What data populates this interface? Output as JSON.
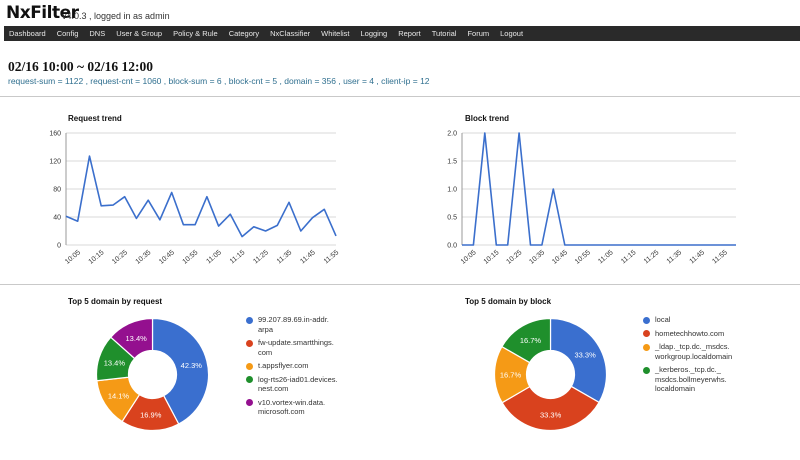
{
  "header": {
    "logo": "NxFilter",
    "version": "v4.0.3 , logged in as admin"
  },
  "nav": {
    "items": [
      "Dashboard",
      "Config",
      "DNS",
      "User & Group",
      "Policy & Rule",
      "Category",
      "NxClassifier",
      "Whitelist",
      "Logging",
      "Report",
      "Tutorial",
      "Forum",
      "Logout"
    ]
  },
  "period": "02/16 10:00 ~ 02/16 12:00",
  "summary": "request-sum = 1122 , request-cnt = 1060 , block-sum = 6 , block-cnt = 5 , domain = 356 , user = 4 , client-ip = 12",
  "chart_data": [
    {
      "type": "line",
      "title": "Request trend",
      "x": [
        "10:01",
        "10:05",
        "10:10",
        "10:15",
        "10:20",
        "10:25",
        "10:30",
        "10:35",
        "10:40",
        "10:45",
        "10:50",
        "10:55",
        "11:00",
        "11:05",
        "11:10",
        "11:15",
        "11:20",
        "11:25",
        "11:30",
        "11:35",
        "11:40",
        "11:45",
        "11:50",
        "11:55",
        "12:00"
      ],
      "tick_labels": [
        "10:05",
        "10:15",
        "10:25",
        "10:35",
        "10:45",
        "10:55",
        "11:05",
        "11:15",
        "11:25",
        "11:35",
        "11:45",
        "11:55"
      ],
      "values": [
        41,
        34,
        127,
        56,
        57,
        69,
        38,
        64,
        36,
        75,
        29,
        29,
        69,
        27,
        44,
        12,
        26,
        20,
        28,
        61,
        20,
        39,
        51,
        13
      ],
      "ylim": [
        0,
        160
      ],
      "yticks": [
        0,
        40,
        80,
        120,
        160
      ],
      "color": "#3b6fcc",
      "grid": true
    },
    {
      "type": "line",
      "title": "Block trend",
      "x": [
        "10:01",
        "10:05",
        "10:10",
        "10:15",
        "10:20",
        "10:25",
        "10:30",
        "10:35",
        "10:40",
        "10:45",
        "10:50",
        "10:55",
        "11:00",
        "11:05",
        "11:10",
        "11:15",
        "11:20",
        "11:25",
        "11:30",
        "11:35",
        "11:40",
        "11:45",
        "11:50",
        "11:55",
        "12:00"
      ],
      "tick_labels": [
        "10:05",
        "10:15",
        "10:25",
        "10:35",
        "10:45",
        "10:55",
        "11:05",
        "11:15",
        "11:25",
        "11:35",
        "11:45",
        "11:55"
      ],
      "values": [
        0,
        0,
        2,
        0,
        0,
        2,
        0,
        0,
        1,
        0,
        0,
        0,
        0,
        0,
        0,
        0,
        0,
        0,
        0,
        0,
        0,
        0,
        0,
        0,
        0
      ],
      "ylim": [
        0,
        2
      ],
      "yticks": [
        "0.0",
        "0.5",
        "1.0",
        "1.5",
        "2.0"
      ],
      "color": "#3b6fcc",
      "grid": true
    },
    {
      "type": "pie",
      "title": "Top 5 domain by request",
      "labels": [
        "99.207.89.69.in-addr.\narpa",
        "fw-update.smartthings.\ncom",
        "t.appsflyer.com",
        "log-rts26-iad01.devices.\nnest.com",
        "v10.vortex-win.data.\nmicrosoft.com"
      ],
      "values": [
        42.3,
        16.9,
        14.1,
        13.4,
        13.4
      ],
      "value_labels": [
        "42.3%",
        "16.9%",
        "14.1%",
        "13.4%",
        "13.4%"
      ],
      "colors": [
        "#3a6fcf",
        "#d9421e",
        "#f59a16",
        "#1f8f2c",
        "#94108f"
      ]
    },
    {
      "type": "pie",
      "title": "Top 5 domain by block",
      "labels": [
        "local",
        "hometechhowto.com",
        "_ldap._tcp.dc._msdcs.\nworkgroup.localdomain",
        "_kerberos._tcp.dc._\nmsdcs.bollmeyerwhs.\nlocaldomain"
      ],
      "values": [
        33.3,
        33.3,
        16.7,
        16.7
      ],
      "value_labels": [
        "33.3%",
        "33.3%",
        "16.7%",
        "16.7%"
      ],
      "colors": [
        "#3a6fcf",
        "#d9421e",
        "#f59a16",
        "#1f8f2c"
      ]
    }
  ]
}
